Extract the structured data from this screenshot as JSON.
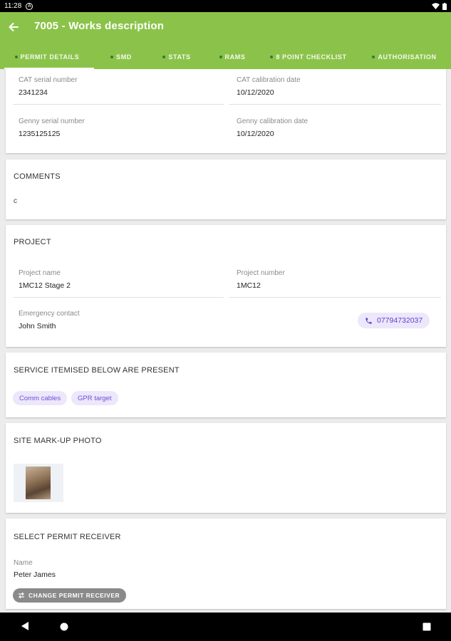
{
  "status_bar": {
    "time": "11:28",
    "notification_glyph": "A"
  },
  "app_bar": {
    "title": "7005 - Works description",
    "tabs": [
      {
        "label": "PERMIT DETAILS",
        "active": true
      },
      {
        "label": "SMD"
      },
      {
        "label": "STATS"
      },
      {
        "label": "RAMS"
      },
      {
        "label": "8 POINT CHECKLIST"
      },
      {
        "label": "AUTHORISATION"
      }
    ]
  },
  "equipment": {
    "cat_serial": {
      "label": "CAT serial number",
      "value": "2341234"
    },
    "cat_calibration": {
      "label": "CAT calibration date",
      "value": "10/12/2020"
    },
    "genny_serial": {
      "label": "Genny serial number",
      "value": "1235125125"
    },
    "genny_calibration": {
      "label": "Genny calibration date",
      "value": "10/12/2020"
    }
  },
  "comments": {
    "title": "COMMENTS",
    "value": "c"
  },
  "project": {
    "title": "PROJECT",
    "name": {
      "label": "Project name",
      "value": "1MC12 Stage 2"
    },
    "number": {
      "label": "Project number",
      "value": "1MC12"
    },
    "emergency": {
      "label": "Emergency contact",
      "value": "John Smith"
    },
    "phone": "07794732037"
  },
  "services": {
    "title": "SERVICE ITEMISED BELOW ARE PRESENT",
    "chips": [
      "Comm cables",
      "GPR target"
    ]
  },
  "photo": {
    "title": "SITE MARK-UP PHOTO"
  },
  "receiver": {
    "title": "SELECT PERMIT RECEIVER",
    "name_label": "Name",
    "name_value": "Peter James",
    "change_button": "CHANGE PERMIT RECEIVER"
  },
  "colors": {
    "primary": "#8bc34a",
    "chip_bg": "#ede7fb",
    "chip_text": "#6a4fd8"
  }
}
